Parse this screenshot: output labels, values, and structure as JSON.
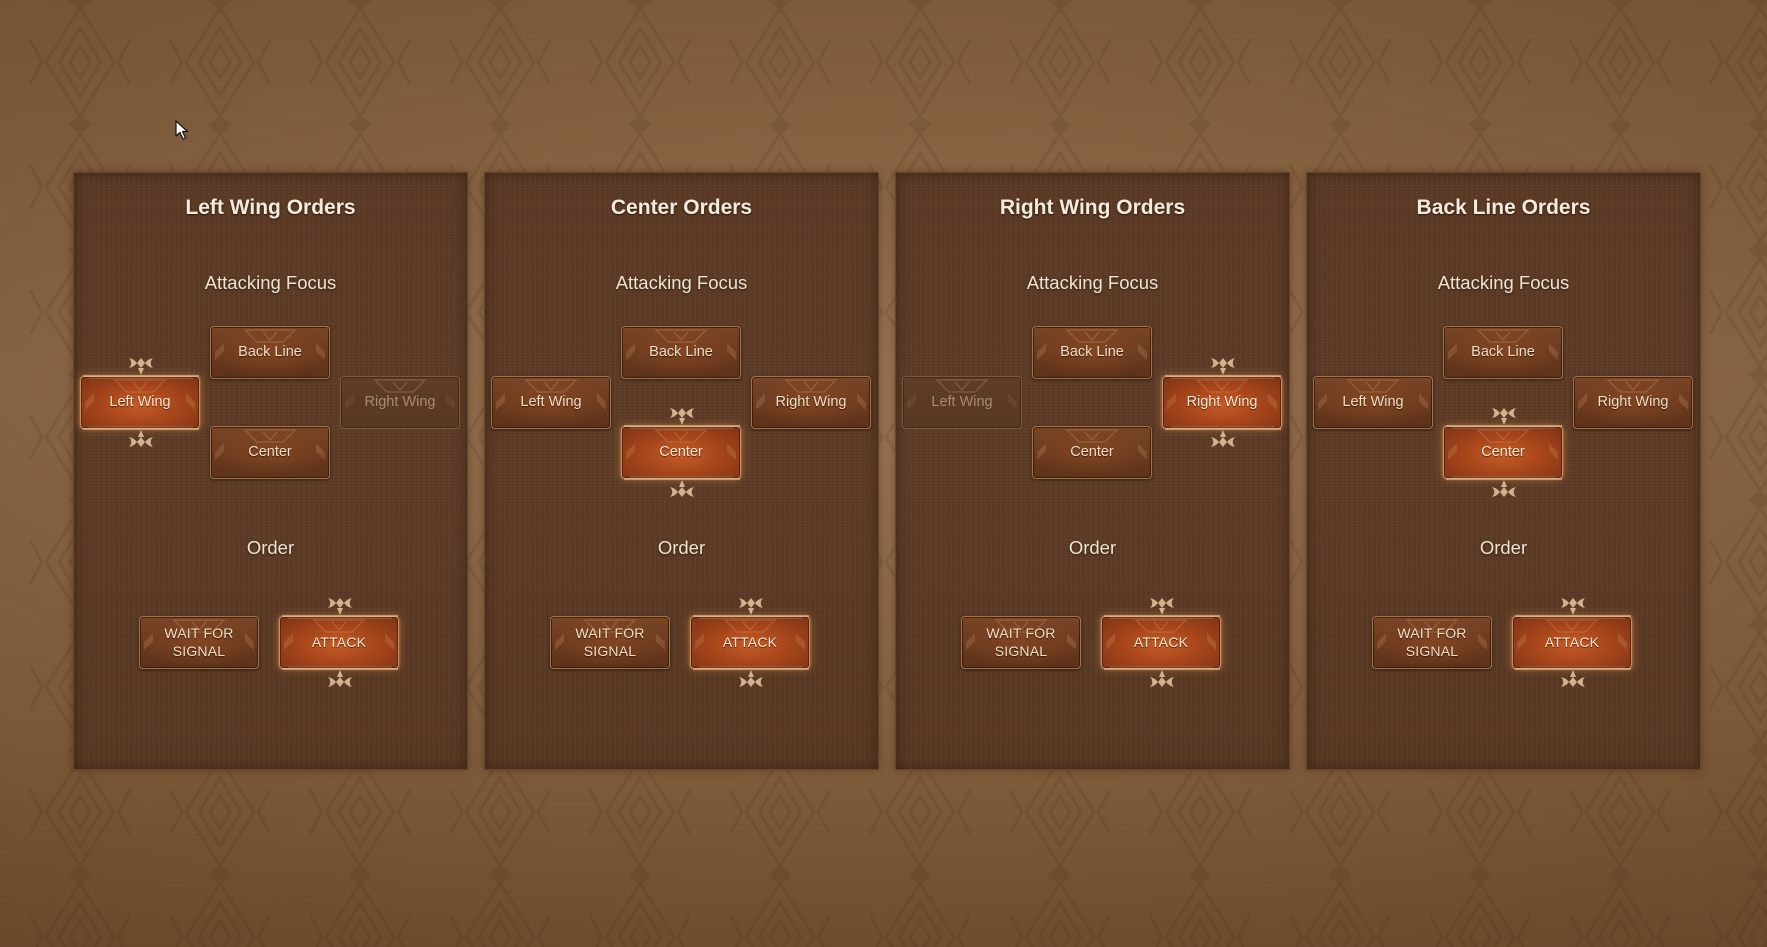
{
  "panels": [
    {
      "title": "Left Wing Orders",
      "focus_label": "Attacking Focus",
      "focus_buttons": {
        "back_line": {
          "label": "Back Line",
          "state": "normal"
        },
        "left_wing": {
          "label": "Left Wing",
          "state": "selected"
        },
        "right_wing": {
          "label": "Right Wing",
          "state": "disabled"
        },
        "center": {
          "label": "Center",
          "state": "normal"
        }
      },
      "order_label": "Order",
      "order_buttons": {
        "wait": {
          "label": "WAIT FOR SIGNAL",
          "state": "normal"
        },
        "attack": {
          "label": "ATTACK",
          "state": "selected"
        }
      }
    },
    {
      "title": "Center Orders",
      "focus_label": "Attacking Focus",
      "focus_buttons": {
        "back_line": {
          "label": "Back Line",
          "state": "normal"
        },
        "left_wing": {
          "label": "Left Wing",
          "state": "normal"
        },
        "right_wing": {
          "label": "Right Wing",
          "state": "normal"
        },
        "center": {
          "label": "Center",
          "state": "selected"
        }
      },
      "order_label": "Order",
      "order_buttons": {
        "wait": {
          "label": "WAIT FOR SIGNAL",
          "state": "normal"
        },
        "attack": {
          "label": "ATTACK",
          "state": "selected"
        }
      }
    },
    {
      "title": "Right Wing Orders",
      "focus_label": "Attacking Focus",
      "focus_buttons": {
        "back_line": {
          "label": "Back Line",
          "state": "normal"
        },
        "left_wing": {
          "label": "Left Wing",
          "state": "disabled"
        },
        "right_wing": {
          "label": "Right Wing",
          "state": "selected"
        },
        "center": {
          "label": "Center",
          "state": "normal"
        }
      },
      "order_label": "Order",
      "order_buttons": {
        "wait": {
          "label": "WAIT FOR SIGNAL",
          "state": "normal"
        },
        "attack": {
          "label": "ATTACK",
          "state": "selected"
        }
      }
    },
    {
      "title": "Back Line Orders",
      "focus_label": "Attacking Focus",
      "focus_buttons": {
        "back_line": {
          "label": "Back Line",
          "state": "normal"
        },
        "left_wing": {
          "label": "Left Wing",
          "state": "normal"
        },
        "right_wing": {
          "label": "Right Wing",
          "state": "normal"
        },
        "center": {
          "label": "Center",
          "state": "selected"
        }
      },
      "order_label": "Order",
      "order_buttons": {
        "wait": {
          "label": "WAIT FOR SIGNAL",
          "state": "normal"
        },
        "attack": {
          "label": "ATTACK",
          "state": "selected"
        }
      }
    }
  ],
  "colors": {
    "background": "#8f6945",
    "panel": "#5b3a26",
    "button": "#6b3a1f",
    "button_selected": "#b84d1f",
    "button_border": "#a57447",
    "text": "#f1dfc4"
  },
  "icons": {
    "cursor": "mouse-pointer-icon",
    "selection_ornament": "ornament-icon",
    "background_motif": "tribal-diamond-pattern"
  }
}
